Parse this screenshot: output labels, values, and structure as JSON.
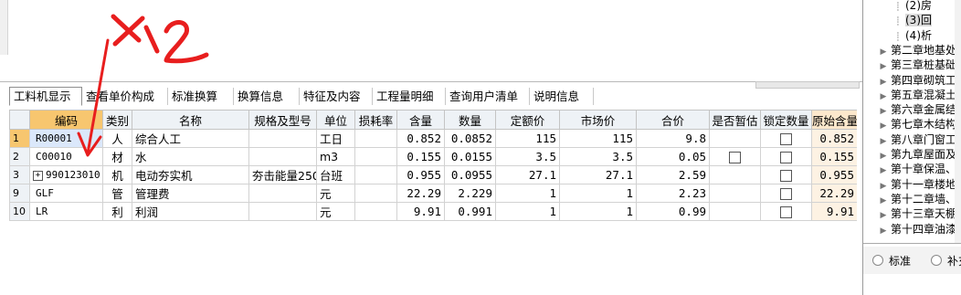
{
  "annotation": {
    "text": "x1.2",
    "color": "#e81e1e"
  },
  "tabs": [
    {
      "label": "工料机显示",
      "active": true
    },
    {
      "label": "查看单价构成"
    },
    {
      "label": "标准换算"
    },
    {
      "label": "换算信息"
    },
    {
      "label": "特征及内容"
    },
    {
      "label": "工程量明细"
    },
    {
      "label": "查询用户清单"
    },
    {
      "label": "说明信息"
    }
  ],
  "table": {
    "headers": [
      "",
      "编码",
      "类别",
      "名称",
      "规格及型号",
      "单位",
      "损耗率",
      "含量",
      "数量",
      "定额价",
      "市场价",
      "合价",
      "是否暂估",
      "锁定数量",
      "原始含量"
    ],
    "rows": [
      {
        "num": "1",
        "code": "R00001",
        "type": "人",
        "name": "综合人工",
        "spec": "",
        "unit": "工日",
        "loss": "",
        "content": "0.852",
        "qty": "0.0852",
        "quota": "115",
        "market": "115",
        "total": "9.8",
        "est": false,
        "lock": true,
        "orig": "0.852"
      },
      {
        "num": "2",
        "code": "C00010",
        "type": "材",
        "name": "水",
        "spec": "",
        "unit": "m3",
        "loss": "",
        "content": "0.155",
        "qty": "0.0155",
        "quota": "3.5",
        "market": "3.5",
        "total": "0.05",
        "est": true,
        "lock": true,
        "orig": "0.155"
      },
      {
        "num": "3",
        "code": "990123010",
        "type": "机",
        "name": "电动夯实机",
        "spec": "夯击能量250",
        "unit": "台班",
        "loss": "",
        "content": "0.955",
        "qty": "0.0955",
        "quota": "27.1",
        "market": "27.1",
        "total": "2.59",
        "est": false,
        "lock": true,
        "orig": "0.955",
        "expandable": true
      },
      {
        "num": "9",
        "code": "GLF",
        "type": "管",
        "name": "管理费",
        "spec": "",
        "unit": "元",
        "loss": "",
        "content": "22.29",
        "qty": "2.229",
        "quota": "1",
        "market": "1",
        "total": "2.23",
        "est": false,
        "lock": true,
        "orig": "22.29"
      },
      {
        "num": "10",
        "code": "LR",
        "type": "利",
        "name": "利润",
        "spec": "",
        "unit": "元",
        "loss": "",
        "content": "9.91",
        "qty": "0.991",
        "quota": "1",
        "market": "1",
        "total": "0.99",
        "est": false,
        "lock": true,
        "orig": "9.91"
      }
    ]
  },
  "tree": {
    "items": [
      {
        "label": "(2)房",
        "indent": 2
      },
      {
        "label": "(3)回",
        "indent": 2
      },
      {
        "label": "(4)析",
        "indent": 2
      },
      {
        "label": "第二章地基处",
        "indent": 1
      },
      {
        "label": "第三章桩基础",
        "indent": 1
      },
      {
        "label": "第四章砌筑工",
        "indent": 1
      },
      {
        "label": "第五章混凝土",
        "indent": 1
      },
      {
        "label": "第六章金属结",
        "indent": 1
      },
      {
        "label": "第七章木结构",
        "indent": 1
      },
      {
        "label": "第八章门窗工",
        "indent": 1
      },
      {
        "label": "第九章屋面及",
        "indent": 1
      },
      {
        "label": "第十章保温、",
        "indent": 1
      },
      {
        "label": "第十一章楼地",
        "indent": 1
      },
      {
        "label": "第十二章墙、",
        "indent": 1
      },
      {
        "label": "第十三章天棚",
        "indent": 1
      },
      {
        "label": "第十四章油漆",
        "indent": 1
      }
    ]
  },
  "radio": {
    "standard": "标准",
    "supplement": "补充"
  }
}
